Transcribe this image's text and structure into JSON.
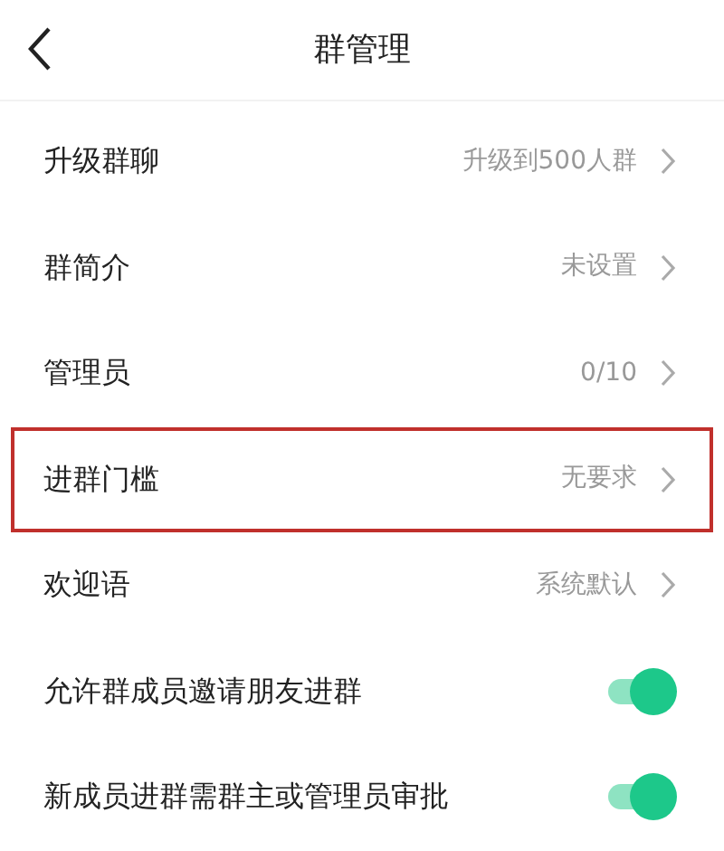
{
  "header": {
    "title": "群管理"
  },
  "rows": [
    {
      "kind": "link",
      "label": "升级群聊",
      "value": "升级到500人群",
      "highlighted": false
    },
    {
      "kind": "link",
      "label": "群简介",
      "value": "未设置",
      "highlighted": false
    },
    {
      "kind": "link",
      "label": "管理员",
      "value": "0/10",
      "highlighted": false
    },
    {
      "kind": "link",
      "label": "进群门槛",
      "value": "无要求",
      "highlighted": true
    },
    {
      "kind": "link",
      "label": "欢迎语",
      "value": "系统默认",
      "highlighted": false
    },
    {
      "kind": "toggle",
      "label": "允许群成员邀请朋友进群",
      "on": true
    },
    {
      "kind": "toggle",
      "label": "新成员进群需群主或管理员审批",
      "on": true
    }
  ]
}
